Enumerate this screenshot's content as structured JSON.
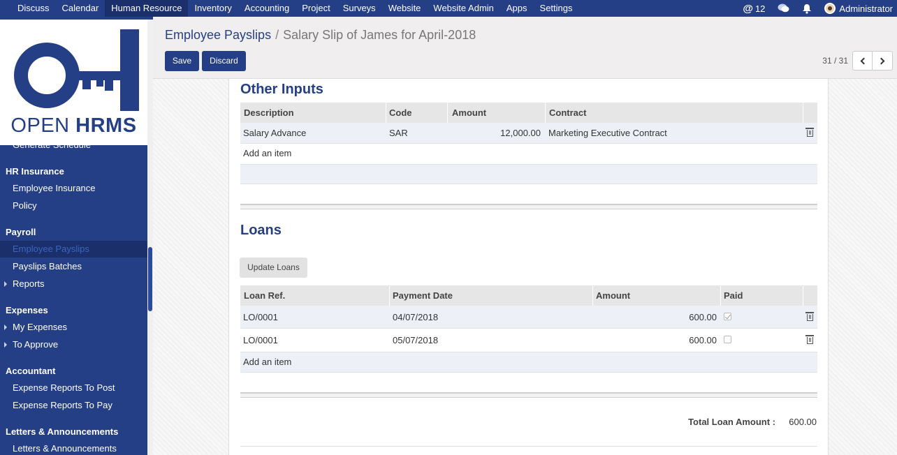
{
  "topbar": {
    "menu": [
      "Discuss",
      "Calendar",
      "Human Resource",
      "Inventory",
      "Accounting",
      "Project",
      "Surveys",
      "Website",
      "Website Admin",
      "Apps",
      "Settings"
    ],
    "active_menu": "Human Resource",
    "mentions_count": "12",
    "user_name": "Administrator"
  },
  "logo": {
    "text_light": "OPEN ",
    "text_bold": "HRMS"
  },
  "sidebar": {
    "partial_top_item": "Generate Schedule",
    "sections": [
      {
        "title": "HR Insurance",
        "items": [
          "Employee Insurance",
          "Policy"
        ]
      },
      {
        "title": "Payroll",
        "items": [
          "Employee Payslips",
          "Payslips Batches",
          "Reports"
        ]
      },
      {
        "title": "Expenses",
        "items": [
          "My Expenses",
          "To Approve"
        ]
      },
      {
        "title": "Accountant",
        "items": [
          "Expense Reports To Post",
          "Expense Reports To Pay"
        ]
      },
      {
        "title": "Letters & Announcements",
        "items": [
          "Letters & Announcements"
        ]
      }
    ],
    "selected_item": "Employee Payslips"
  },
  "control_panel": {
    "breadcrumb_parent": "Employee Payslips",
    "breadcrumb_sep": "/",
    "breadcrumb_current": "Salary Slip of James for April-2018",
    "save_label": "Save",
    "discard_label": "Discard",
    "pager": "31 / 31"
  },
  "other_inputs": {
    "title": "Other Inputs",
    "columns": [
      "Description",
      "Code",
      "Amount",
      "Contract"
    ],
    "rows": [
      {
        "description": "Salary Advance",
        "code": "SAR",
        "amount": "12,000.00",
        "contract": "Marketing Executive Contract"
      }
    ],
    "add_label": "Add an item"
  },
  "loans": {
    "title": "Loans",
    "update_label": "Update Loans",
    "columns": [
      "Loan Ref.",
      "Payment Date",
      "Amount",
      "Paid"
    ],
    "rows": [
      {
        "ref": "LO/0001",
        "date": "04/07/2018",
        "amount": "600.00",
        "paid": true
      },
      {
        "ref": "LO/0001",
        "date": "05/07/2018",
        "amount": "600.00",
        "paid": false
      }
    ],
    "add_label": "Add an item",
    "total_label": "Total Loan Amount :",
    "total_value": "600.00"
  }
}
